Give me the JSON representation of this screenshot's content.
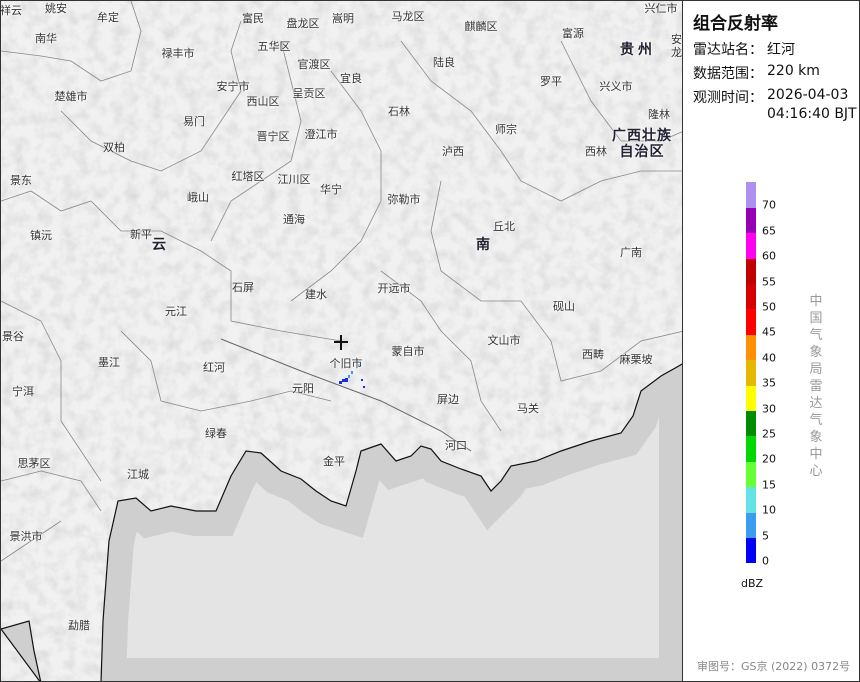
{
  "panel": {
    "title": "组合反射率",
    "station_label": "雷达站名：",
    "station": "红河",
    "range_label": "数据范围：",
    "range": "220 km",
    "time_label": "观测时间：",
    "date": "2026-04-03",
    "time": "04:16:40 BJT",
    "organization": "中国气象局雷达气象中心",
    "approval": "审图号：GS京 (2022) 0372号"
  },
  "legend": {
    "unit": "dBZ",
    "ticks": [
      "0",
      "5",
      "10",
      "15",
      "20",
      "25",
      "30",
      "35",
      "40",
      "45",
      "50",
      "55",
      "60",
      "65",
      "70"
    ],
    "colors": [
      "#0000f6",
      "#3c9cf0",
      "#63e3e3",
      "#66ff33",
      "#00d800",
      "#008c00",
      "#ffff00",
      "#e6b800",
      "#ff9000",
      "#ff0000",
      "#d60000",
      "#c00000",
      "#ff00f0",
      "#9600b4",
      "#ae90f0"
    ]
  },
  "map": {
    "radar_station_icon": "crosshair-icon",
    "labels": [
      "祥云",
      "姚安",
      "牟定",
      "南华",
      "禄丰市",
      "富民",
      "盘龙区",
      "嵩明",
      "马龙区",
      "麒麟区",
      "富源",
      "兴仁市",
      "五华区",
      "官渡区",
      "安宁市",
      "西山区",
      "呈贡区",
      "宜良",
      "陆良",
      "罗平",
      "兴义市",
      "贵州",
      "安龙",
      "楚雄市",
      "易门",
      "晋宁区",
      "澄江市",
      "石林",
      "师宗",
      "隆林",
      "广西壮族自治区",
      "西林",
      "泸西",
      "双柏",
      "景东",
      "红塔区",
      "江川区",
      "华宁",
      "峨山",
      "弥勒市",
      "通海",
      "丘北",
      "镇沅",
      "新平",
      "云",
      "南",
      "广南",
      "石屏",
      "建水",
      "开远市",
      "砚山",
      "元江",
      "景谷",
      "文山市",
      "蒙自市",
      "个旧市",
      "西畴",
      "麻栗坡",
      "墨江",
      "红河",
      "宁洱",
      "元阳",
      "屏边",
      "马关",
      "绿春",
      "河口",
      "思茅区",
      "金平",
      "江城",
      "景洪市",
      "勐腊"
    ]
  }
}
